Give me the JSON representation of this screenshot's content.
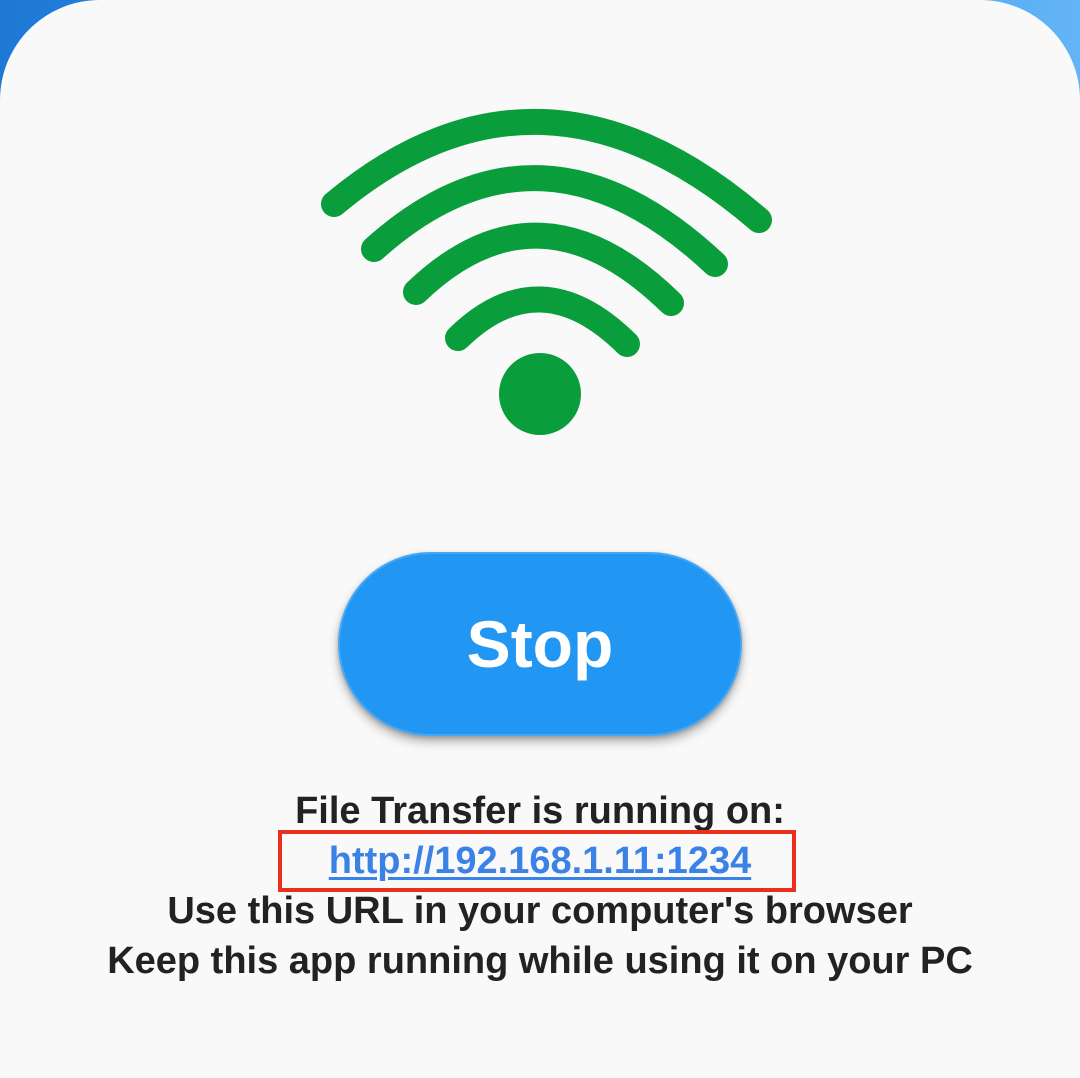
{
  "app": {
    "status_title": "File Transfer is running on:",
    "url": "http://192.168.1.11:1234",
    "hint_line_1": "Use this URL in your computer's browser",
    "hint_line_2": "Keep this app running while using it on your PC"
  },
  "controls": {
    "stop_label": "Stop"
  },
  "icons": {
    "status_icon": "wifi-icon"
  },
  "colors": {
    "wifi_green": "#0a9d3c",
    "button_blue": "#2196f3",
    "link_blue": "#3b82e6",
    "highlight_red": "#e8301c",
    "background": "#f9f9f9"
  }
}
